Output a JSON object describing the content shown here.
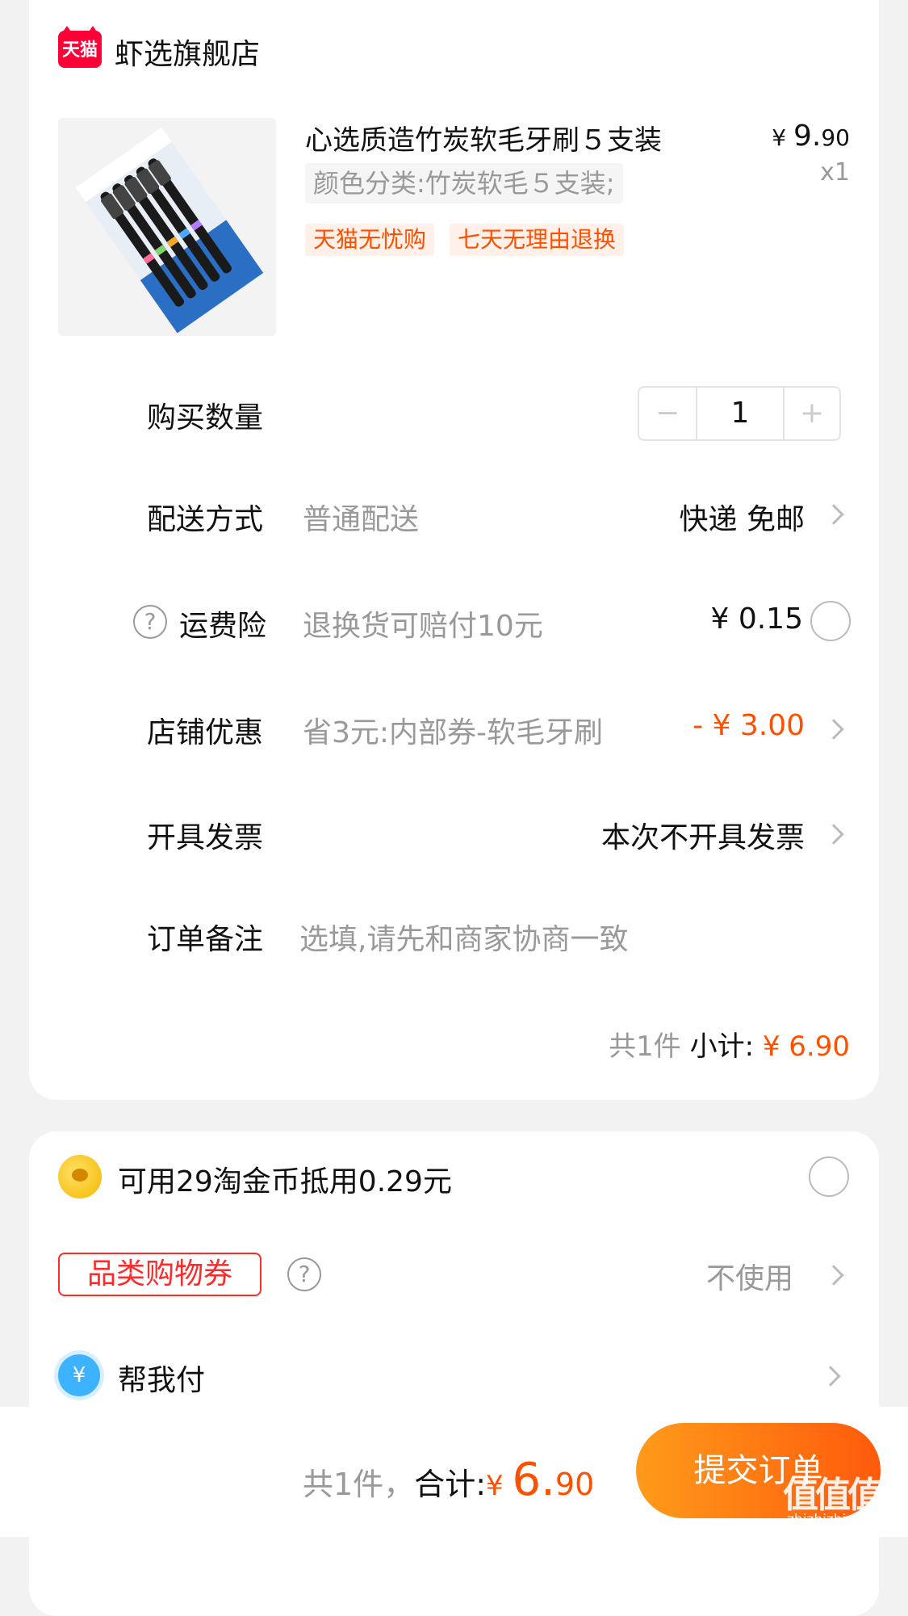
{
  "store": {
    "badge": "天猫",
    "name": "虾选旗舰店"
  },
  "product": {
    "title": "心选质造竹炭软毛牙刷５支装",
    "sku": "颜色分类:竹炭软毛５支装;",
    "price_yen": "¥ ",
    "price_int": "9.",
    "price_dec": "90",
    "quantity_mult": "x1",
    "tags": [
      "天猫无忧购",
      "七天无理由退换"
    ]
  },
  "quantity": {
    "label": "购买数量",
    "minus": "−",
    "value": "1",
    "plus": "+"
  },
  "delivery": {
    "label": "配送方式",
    "desc": "普通配送",
    "value": "快递 免邮"
  },
  "insurance": {
    "label": "运费险",
    "desc": "退换货可赔付10元",
    "value": "¥ 0.15",
    "help_glyph": "?"
  },
  "shop_discount": {
    "label": "店铺优惠",
    "desc": "省3元:内部券-软毛牙刷",
    "value": "- ¥ 3.00"
  },
  "invoice": {
    "label": "开具发票",
    "value": "本次不开具发票"
  },
  "remark": {
    "label": "订单备注",
    "placeholder": "选填,请先和商家协商一致"
  },
  "subtotal": {
    "count": "共1件 ",
    "label": "小计: ",
    "amount": "¥ 6.90"
  },
  "coins": {
    "text": "可用29淘金币抵用0.29元"
  },
  "category_coupon": {
    "label": "品类购物券",
    "value": "不使用",
    "help_glyph": "?"
  },
  "help_pay": {
    "icon_glyph": "¥",
    "label": "帮我付"
  },
  "footer": {
    "count": "共1件，",
    "total_label": "合计:",
    "yen": "¥ ",
    "total_int": "6.",
    "total_dec": "90",
    "submit": "提交订单"
  },
  "watermark": {
    "text": "值值值",
    "url": "zhizhizhi.com"
  },
  "colors": {
    "accent": "#ff5000",
    "tmall_red": "#ff0036",
    "background": "#f2f2f2"
  }
}
